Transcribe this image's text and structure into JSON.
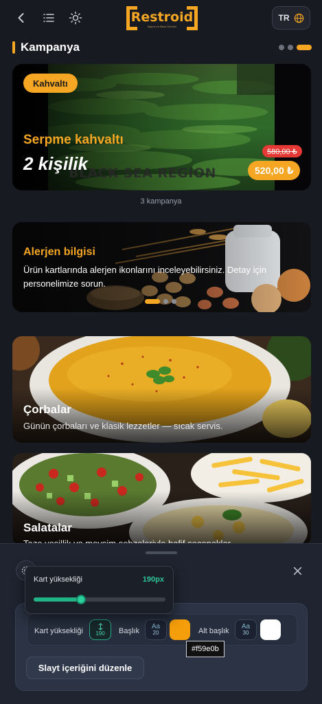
{
  "header": {
    "back_icon": "arrow-left-icon",
    "menu_icon": "list-icon",
    "theme_icon": "sun-icon",
    "logo_text": "Restroid",
    "logo_tagline": "Siparis ve Masa Ürünleri",
    "language_code": "TR",
    "language_icon": "globe-icon"
  },
  "campaign": {
    "title": "Kampanya",
    "active_slide": 3,
    "slide_count": 3,
    "tag": "Kahvaltı",
    "headline": "Serpme kahvaltı",
    "subline": "2 kişilik",
    "photo_caption": "BLACK SEA REGION",
    "old_price": "580,00 ₺",
    "new_price": "520,00 ₺",
    "count_text": "3 kampanya"
  },
  "allergen": {
    "title": "Alerjen bilgisi",
    "text": "Ürün kartlarında alerjen ikonlarını inceleyebilirsiniz. Detay için personelimize sorun.",
    "active_slide": 1,
    "slide_count": 3
  },
  "categories": [
    {
      "title": "Çorbalar",
      "text": "Günün çorbaları ve klasik lezzetler — sıcak servis."
    },
    {
      "title": "Salatalar",
      "text": "Taze yeşillik ve mevsim sebzeleriyle hafif seçenekler."
    }
  ],
  "editor": {
    "settings_icon": "gear-icon",
    "close_icon": "close-icon",
    "slider_label": "Kart yüksekliği",
    "slider_value": "190px",
    "slider_fraction": 0.36,
    "height_label": "Kart yüksekliği",
    "height_value": "190",
    "height_icon": "resize-vertical-icon",
    "title_label": "Başlık",
    "title_size": "20",
    "title_font_icon": "Aa",
    "title_color": "#f59e0b",
    "subtitle_label": "Alt başlık",
    "subtitle_size": "30",
    "subtitle_font_icon": "Aa",
    "subtitle_color": "#ffffff",
    "color_tooltip": "#f59e0b",
    "edit_button": "Slayt içeriğini düzenle"
  },
  "colors": {
    "accent": "#f5a623",
    "price_strike": "#e53935",
    "slider": "#22b384"
  }
}
